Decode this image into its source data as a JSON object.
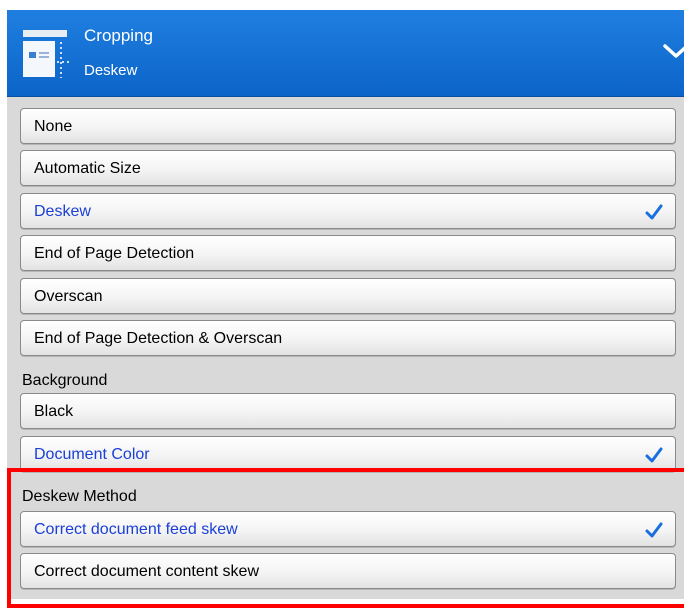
{
  "header": {
    "title": "Cropping",
    "subtitle": "Deskew",
    "icon": "cropping-document-icon",
    "expand_icon": "chevron-down-icon",
    "background_color": "#0c64c8"
  },
  "cropping_options": [
    {
      "label": "None",
      "selected": false
    },
    {
      "label": "Automatic Size",
      "selected": false
    },
    {
      "label": "Deskew",
      "selected": true
    },
    {
      "label": "End of Page Detection",
      "selected": false
    },
    {
      "label": "Overscan",
      "selected": false
    },
    {
      "label": "End of Page Detection & Overscan",
      "selected": false
    }
  ],
  "background": {
    "label": "Background",
    "options": [
      {
        "label": "Black",
        "selected": false
      },
      {
        "label": "Document Color",
        "selected": true
      }
    ]
  },
  "deskew_method": {
    "label": "Deskew Method",
    "options": [
      {
        "label": "Correct document feed skew",
        "selected": true
      },
      {
        "label": "Correct document content skew",
        "selected": false
      }
    ]
  },
  "colors": {
    "selected_text": "#1a3fd6",
    "checkmark": "#1a6fe0",
    "highlight_border": "#ff0000"
  }
}
